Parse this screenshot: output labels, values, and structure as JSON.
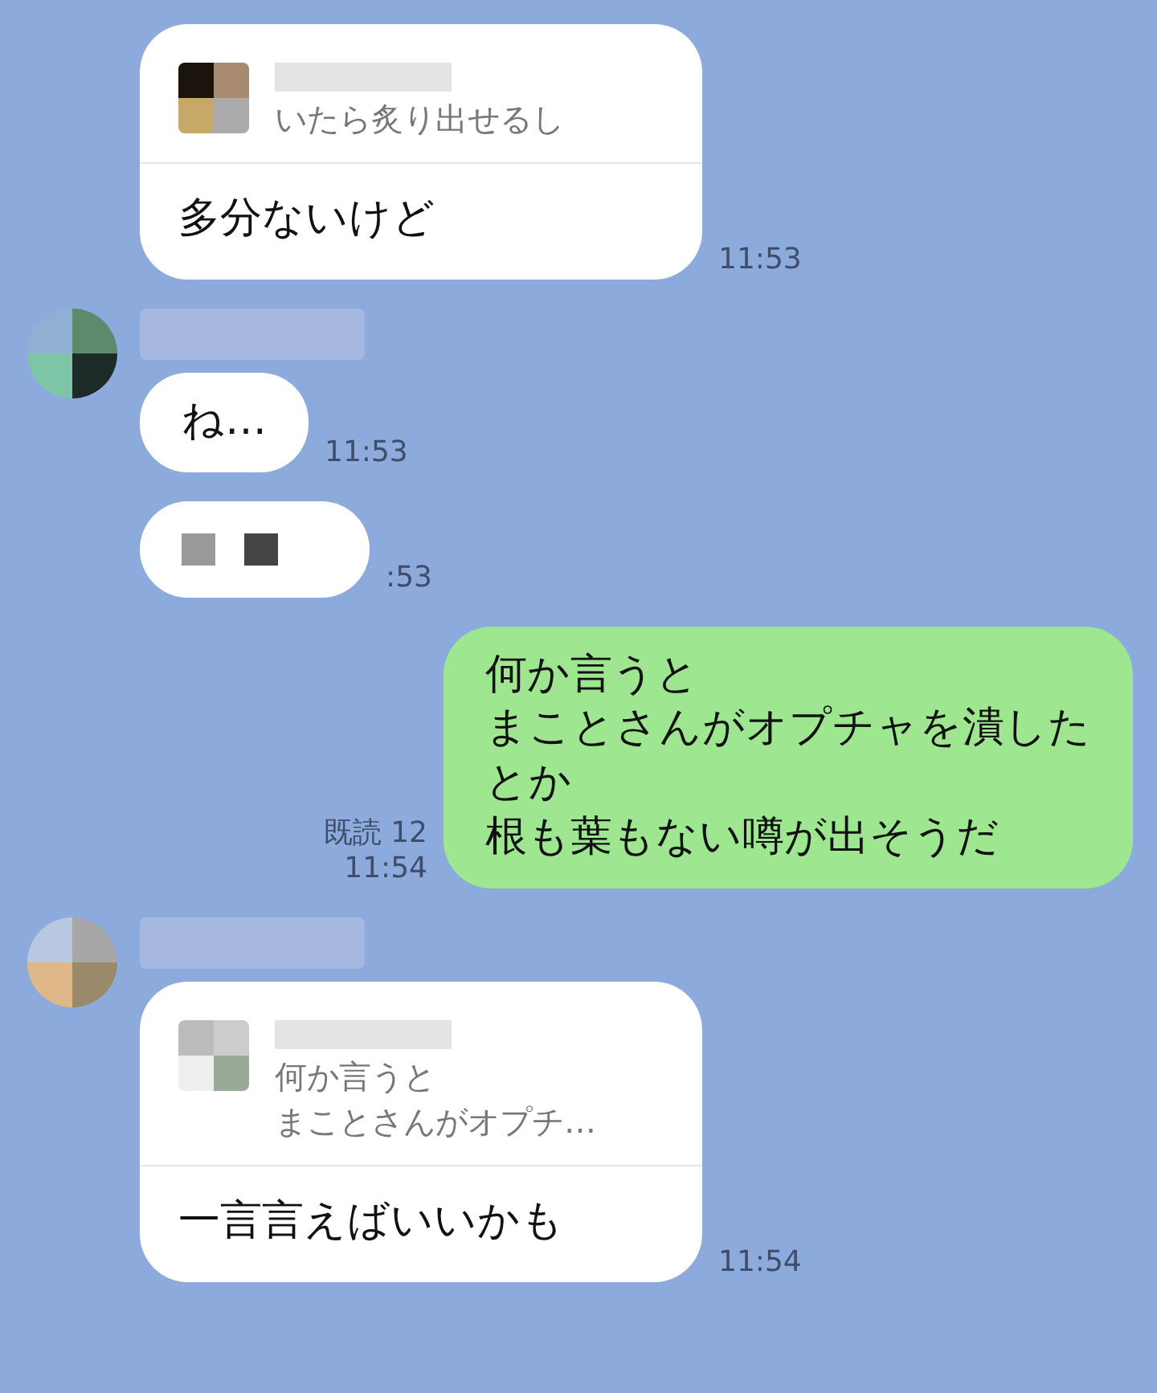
{
  "messages": [
    {
      "kind": "reply",
      "avatar": false,
      "sender_hidden": false,
      "quote_lines": [
        "いたら炙り出せるし"
      ],
      "text": "多分ないけど",
      "time": "11:53"
    },
    {
      "kind": "text",
      "avatar": true,
      "sender_hidden": true,
      "text": "ね…",
      "time": "11:53"
    },
    {
      "kind": "redacted",
      "avatar": false,
      "sender_hidden": false,
      "time": ":53"
    },
    {
      "kind": "sent",
      "lines": [
        "何か言うと",
        "まことさんがオプチャを潰した",
        "とか",
        "根も葉もない噂が出そうだ"
      ],
      "read": "既読 12",
      "time": "11:54"
    },
    {
      "kind": "reply",
      "avatar": true,
      "sender_hidden": true,
      "quote_lines": [
        "何か言うと",
        "まことさんがオプチ…"
      ],
      "text": "一言言えばいいかも",
      "time": "11:54"
    }
  ]
}
